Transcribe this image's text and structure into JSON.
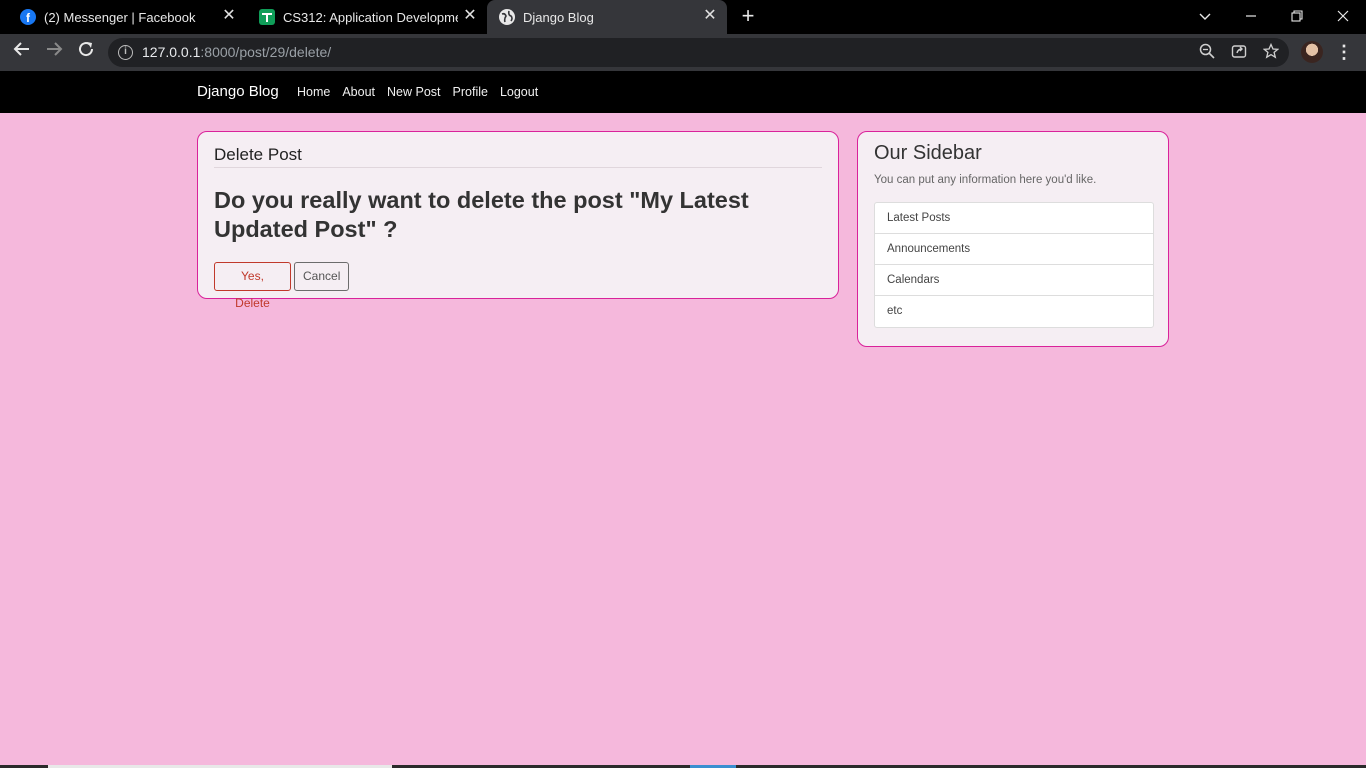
{
  "browser": {
    "tabs": [
      {
        "title": "(2) Messenger | Facebook",
        "icon": "facebook-icon",
        "active": false
      },
      {
        "title": "CS312: Application Development",
        "icon": "classroom-icon",
        "active": false
      },
      {
        "title": "Django Blog",
        "icon": "globe-icon",
        "active": true
      }
    ],
    "url_host": "127.0.0.1",
    "url_rest": ":8000/post/29/delete/"
  },
  "site": {
    "brand": "Django Blog",
    "nav": [
      "Home",
      "About",
      "New Post",
      "Profile",
      "Logout"
    ]
  },
  "main": {
    "legend": "Delete Post",
    "question": "Do you really want to delete the post \"My Latest Updated Post\" ?",
    "delete_label": "Yes, Delete",
    "cancel_label": "Cancel"
  },
  "sidebar": {
    "title": "Our Sidebar",
    "description": "You can put any information here you'd like.",
    "items": [
      "Latest Posts",
      "Announcements",
      "Calendars",
      "etc"
    ]
  },
  "colors": {
    "page_bg": "#f5b8dc",
    "card_border": "#d9229a",
    "danger": "#c0392b"
  }
}
